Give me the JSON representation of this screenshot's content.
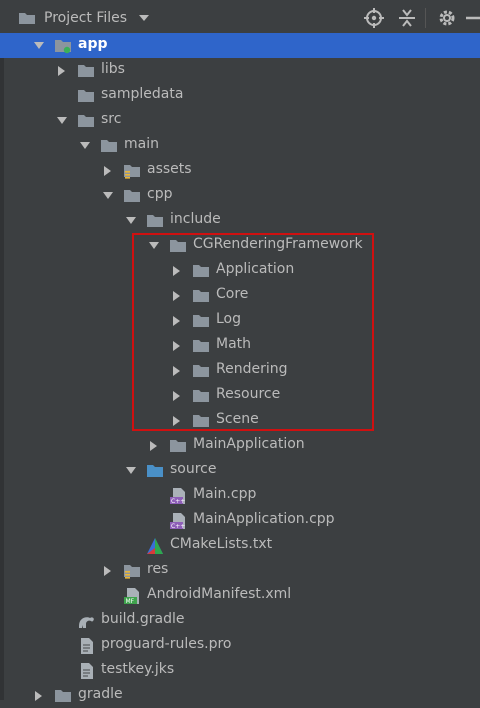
{
  "header": {
    "title": "Project Files",
    "icons": [
      "folder-icon",
      "dropdown-chevron-icon",
      "locate-icon",
      "collapse-all-icon",
      "gear-icon",
      "minimize-icon"
    ]
  },
  "colors": {
    "folder": "#8c959e",
    "source_folder": "#4a90c7",
    "selection": "#2f65ca",
    "highlight_box": "#d01010"
  },
  "tree": [
    {
      "label": "app",
      "level": 0,
      "arrow": "down",
      "icon": "module-folder-icon",
      "selected": true
    },
    {
      "label": "libs",
      "level": 1,
      "arrow": "right",
      "icon": "folder-icon"
    },
    {
      "label": "sampledata",
      "level": 1,
      "arrow": "none",
      "icon": "folder-icon"
    },
    {
      "label": "src",
      "level": 1,
      "arrow": "down",
      "icon": "folder-icon"
    },
    {
      "label": "main",
      "level": 2,
      "arrow": "down",
      "icon": "folder-icon"
    },
    {
      "label": "assets",
      "level": 3,
      "arrow": "right",
      "icon": "resource-folder-icon"
    },
    {
      "label": "cpp",
      "level": 3,
      "arrow": "down",
      "icon": "folder-icon"
    },
    {
      "label": "include",
      "level": 4,
      "arrow": "down",
      "icon": "folder-icon"
    },
    {
      "label": "CGRenderingFramework",
      "level": 5,
      "arrow": "down",
      "icon": "folder-icon"
    },
    {
      "label": "Application",
      "level": 6,
      "arrow": "right",
      "icon": "folder-icon"
    },
    {
      "label": "Core",
      "level": 6,
      "arrow": "right",
      "icon": "folder-icon"
    },
    {
      "label": "Log",
      "level": 6,
      "arrow": "right",
      "icon": "folder-icon"
    },
    {
      "label": "Math",
      "level": 6,
      "arrow": "right",
      "icon": "folder-icon"
    },
    {
      "label": "Rendering",
      "level": 6,
      "arrow": "right",
      "icon": "folder-icon"
    },
    {
      "label": "Resource",
      "level": 6,
      "arrow": "right",
      "icon": "folder-icon"
    },
    {
      "label": "Scene",
      "level": 6,
      "arrow": "right",
      "icon": "folder-icon"
    },
    {
      "label": "MainApplication",
      "level": 5,
      "arrow": "right",
      "icon": "folder-icon"
    },
    {
      "label": "source",
      "level": 4,
      "arrow": "down",
      "icon": "source-folder-icon"
    },
    {
      "label": "Main.cpp",
      "level": 5,
      "arrow": "none",
      "icon": "cpp-file-icon"
    },
    {
      "label": "MainApplication.cpp",
      "level": 5,
      "arrow": "none",
      "icon": "cpp-file-icon"
    },
    {
      "label": "CMakeLists.txt",
      "level": 4,
      "arrow": "none",
      "icon": "cmake-icon"
    },
    {
      "label": "res",
      "level": 3,
      "arrow": "right",
      "icon": "resource-folder-icon"
    },
    {
      "label": "AndroidManifest.xml",
      "level": 3,
      "arrow": "none",
      "icon": "manifest-icon"
    },
    {
      "label": "build.gradle",
      "level": 1,
      "arrow": "none",
      "icon": "gradle-icon"
    },
    {
      "label": "proguard-rules.pro",
      "level": 1,
      "arrow": "none",
      "icon": "text-file-icon"
    },
    {
      "label": "testkey.jks",
      "level": 1,
      "arrow": "none",
      "icon": "text-file-icon"
    },
    {
      "label": "gradle",
      "level": 0,
      "arrow": "right",
      "icon": "folder-icon"
    }
  ]
}
